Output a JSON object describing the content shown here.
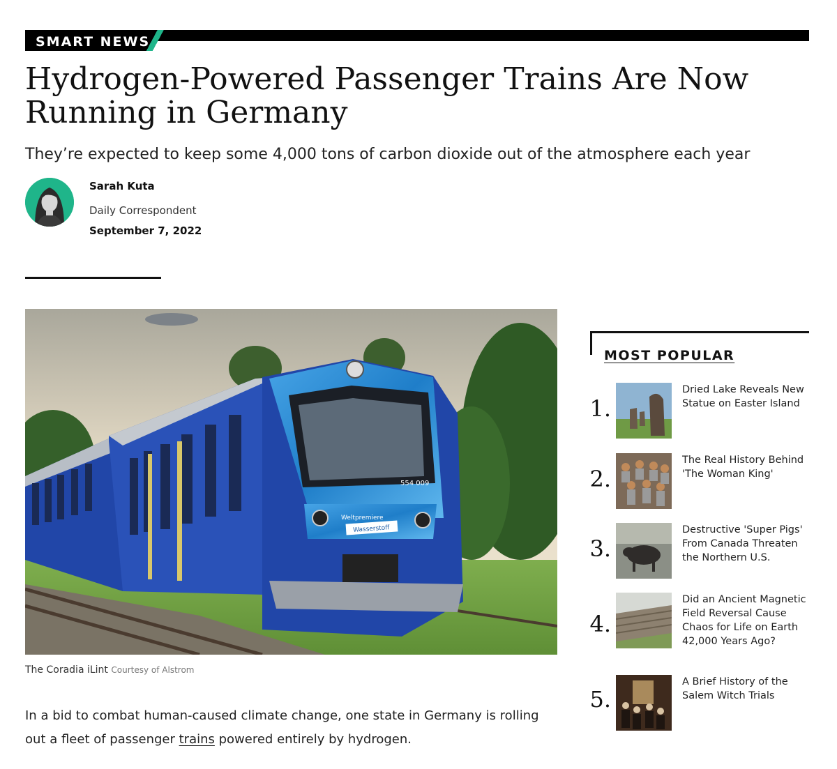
{
  "section_label": "SMART NEWS",
  "article": {
    "headline": "Hydrogen-Powered Passenger Trains Are Now Running in Germany",
    "dek": "They’re expected to keep some 4,000 tons of carbon dioxide out of the atmosphere each year",
    "author": {
      "name": "Sarah Kuta",
      "role": "Daily Correspondent"
    },
    "date": "September 7, 2022",
    "image": {
      "caption": "The Coradia iLint",
      "credit": "Courtesy of Alstrom",
      "number": "554 009",
      "livery_line1": "Weltpremiere",
      "livery_line2": "Wasserstoff"
    },
    "body": {
      "before_link": "In a bid to combat human-caused climate change, one state in Germany is rolling out a fleet of passenger ",
      "link_text": "trains",
      "after_link": " powered entirely by hydrogen."
    }
  },
  "most_popular": {
    "title": "MOST POPULAR",
    "items": [
      {
        "num": "1.",
        "title": "Dried Lake Reveals New Statue on Easter Island",
        "thumb_icon": "moai-statues"
      },
      {
        "num": "2.",
        "title": "The Real History Behind 'The Woman King'",
        "thumb_icon": "warriors-group"
      },
      {
        "num": "3.",
        "title": "Destructive 'Super Pigs' From Canada Threaten the Northern U.S.",
        "thumb_icon": "wild-pig"
      },
      {
        "num": "4.",
        "title": "Did an Ancient Magnetic Field Reversal Cause Chaos for Life on Earth 42,000 Years Ago?",
        "thumb_icon": "tree-log"
      },
      {
        "num": "5.",
        "title": "A Brief History of the Salem Witch Trials",
        "thumb_icon": "courtroom-painting"
      }
    ]
  },
  "colors": {
    "accent": "#1fb58a",
    "train_blue": "#2146a8",
    "train_cyan": "#2d8fd6"
  }
}
